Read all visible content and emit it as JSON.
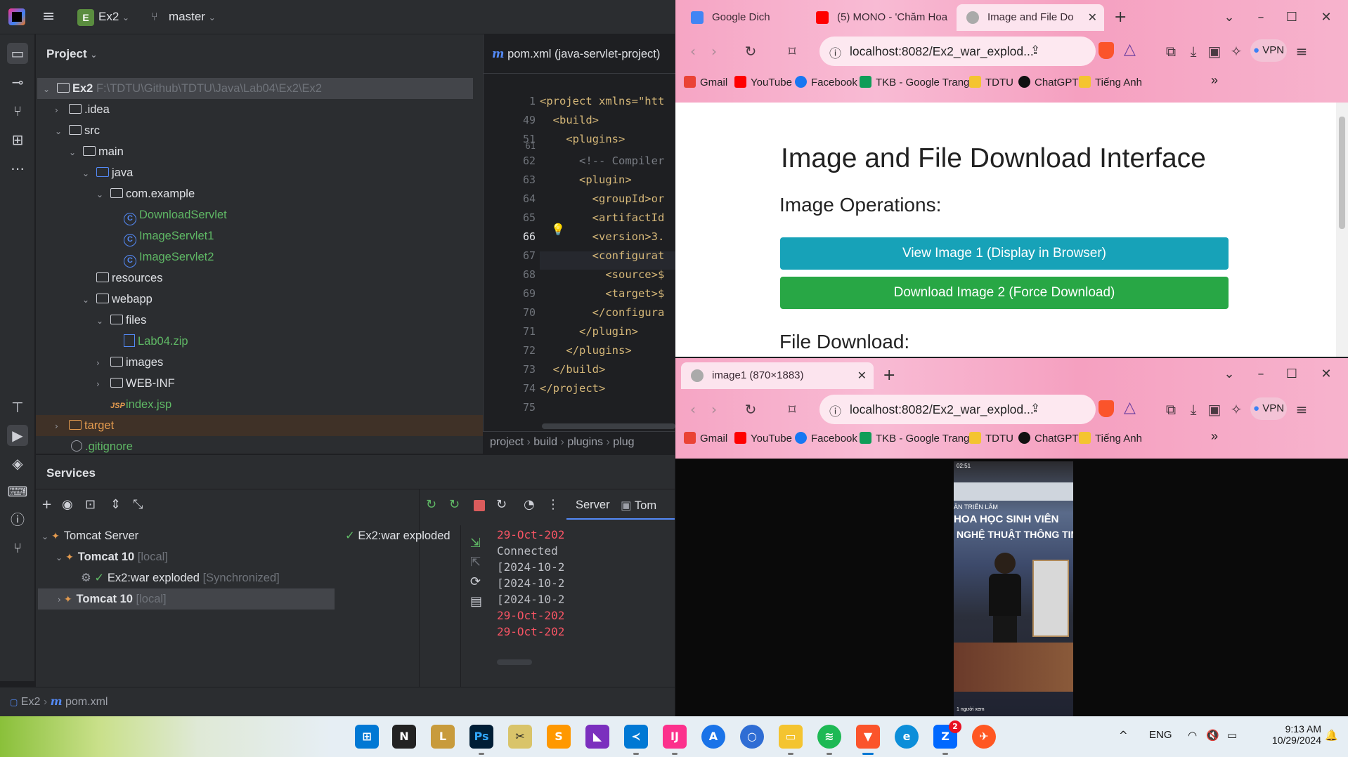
{
  "ide": {
    "project_badge": "E",
    "project_name": "Ex2",
    "branch": "master",
    "panel_title": "Project",
    "tree": [
      {
        "name": "Ex2",
        "path": "F:\\TDTU\\Github\\TDTU\\Java\\Lab04\\Ex2\\Ex2"
      },
      {
        "name": ".idea"
      },
      {
        "name": "src"
      },
      {
        "name": "main"
      },
      {
        "name": "java"
      },
      {
        "name": "com.example"
      },
      {
        "name": "DownloadServlet"
      },
      {
        "name": "ImageServlet1"
      },
      {
        "name": "ImageServlet2"
      },
      {
        "name": "resources"
      },
      {
        "name": "webapp"
      },
      {
        "name": "files"
      },
      {
        "name": "Lab04.zip"
      },
      {
        "name": "images"
      },
      {
        "name": "WEB-INF"
      },
      {
        "name": "index.jsp"
      },
      {
        "name": "target"
      },
      {
        "name": ".gitignore"
      }
    ],
    "editor_tab": "pom.xml (java-servlet-project)",
    "line_numbers": [
      "1",
      "49",
      "51",
      "61",
      "62",
      "63",
      "64",
      "65",
      "66",
      "67",
      "68",
      "69",
      "70",
      "71",
      "72",
      "73",
      "74",
      "75"
    ],
    "code_lines": [
      "<project xmlns=\"htt",
      "  <build>",
      "    <plugins>",
      "",
      "      <!-- Compiler",
      "      <plugin>",
      "        <groupId>or",
      "        <artifactId",
      "        <version>3.",
      "        <configurat",
      "          <source>$",
      "          <target>$",
      "        </configura",
      "      </plugin>",
      "    </plugins>",
      "  </build>",
      "</project>",
      ""
    ],
    "breadcrumbs": [
      "project",
      "build",
      "plugins",
      "plug"
    ],
    "services_title": "Services",
    "services_tree": [
      {
        "label": "Tomcat Server"
      },
      {
        "label": "Tomcat 10",
        "tag": "[local]"
      },
      {
        "label": "Ex2:war exploded",
        "tag": "[Synchronized]"
      },
      {
        "label": "Tomcat 10",
        "tag": "[local]"
      }
    ],
    "deploy_item": "Ex2:war exploded",
    "console_tabs": [
      "Server",
      "Tom"
    ],
    "console_lines": [
      "29-Oct-202",
      "Connected ",
      "[2024-10-2",
      "[2024-10-2",
      "[2024-10-2",
      "29-Oct-202",
      "29-Oct-202"
    ],
    "status_path": [
      "Ex2",
      "pom.xml"
    ]
  },
  "browser_top": {
    "tabs": [
      "Google Dich",
      "(5) MONO - 'Chăm Hoa",
      "Image and File Do"
    ],
    "url": "localhost:8082/Ex2_war_explod...",
    "vpn": "VPN",
    "bookmarks": [
      "Gmail",
      "YouTube",
      "Facebook",
      "TKB - Google Trang...",
      "TDTU",
      "ChatGPT",
      "Tiếng Anh"
    ],
    "page": {
      "title": "Image and File Download Interface",
      "section1": "Image Operations:",
      "btn_view": "View Image 1 (Display in Browser)",
      "btn_download": "Download Image 2 (Force Download)",
      "section2": "File Download:"
    }
  },
  "browser_bottom": {
    "tab": "image1 (870×1883)",
    "url": "localhost:8082/Ex2_war_explod...",
    "vpn": "VPN",
    "bookmarks": [
      "Gmail",
      "YouTube",
      "Facebook",
      "TKB - Google Trang...",
      "TDTU",
      "ChatGPT",
      "Tiếng Anh"
    ],
    "image_text": {
      "time": "02:51",
      "headline1": "ÂN TRIỂN LÃM",
      "headline2": "HOA HỌC SINH VIÊN",
      "headline3": "NGHỆ THUẬT THÔNG TIN",
      "footer": "1 người xem"
    }
  },
  "taskbar": {
    "lang": "ENG",
    "time": "9:13 AM",
    "date": "10/29/2024",
    "badge": "2"
  },
  "colors": {
    "btn_view": "#17a2b8",
    "btn_download": "#28a745",
    "browser_frame": "#f6a5c4"
  }
}
